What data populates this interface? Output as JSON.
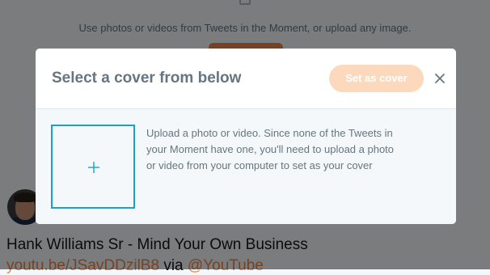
{
  "background": {
    "hint_text": "Use photos or videos from Tweets in the Moment, or upload any image.",
    "tweet_title": "Hank Williams Sr - Mind Your Own Business",
    "tweet_link": "youtu.be/JSavDDzilB8",
    "tweet_via": " via ",
    "tweet_mention": "@YouTube"
  },
  "modal": {
    "title": "Select a cover from below",
    "set_cover_label": "Set as cover",
    "close_icon": "close-icon",
    "upload_icon": "plus-icon",
    "upload_text": "Upload a photo or video. Since none of the Tweets in your Moment have one, you'll need to upload a photo or video from your computer to set as your cover"
  },
  "colors": {
    "accent": "#1da1c4",
    "button_disabled": "#fcd9bd",
    "title": "#66757f"
  }
}
